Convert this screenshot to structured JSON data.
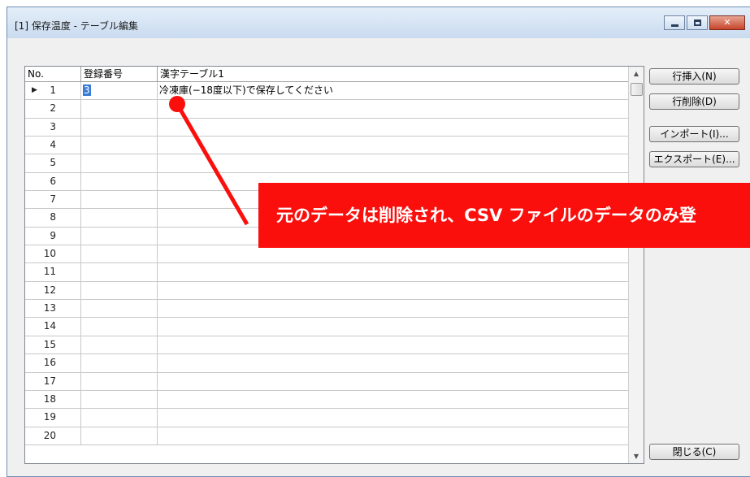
{
  "window": {
    "title": "[1] 保存温度 - テーブル編集",
    "controls": {
      "minimize": "–",
      "maximize": "□",
      "close": "✕"
    },
    "help_glyph": "?"
  },
  "grid": {
    "headers": {
      "no": "No.",
      "reg": "登録番号",
      "kanji": "漢字テーブル1"
    },
    "rows": [
      {
        "no": "1",
        "reg": "3",
        "kanji": "冷凍庫(−18度以下)で保存してください",
        "current": true
      },
      {
        "no": "2",
        "reg": "",
        "kanji": ""
      },
      {
        "no": "3",
        "reg": "",
        "kanji": ""
      },
      {
        "no": "4",
        "reg": "",
        "kanji": ""
      },
      {
        "no": "5",
        "reg": "",
        "kanji": ""
      },
      {
        "no": "6",
        "reg": "",
        "kanji": ""
      },
      {
        "no": "7",
        "reg": "",
        "kanji": ""
      },
      {
        "no": "8",
        "reg": "",
        "kanji": ""
      },
      {
        "no": "9",
        "reg": "",
        "kanji": ""
      },
      {
        "no": "10",
        "reg": "",
        "kanji": ""
      },
      {
        "no": "11",
        "reg": "",
        "kanji": ""
      },
      {
        "no": "12",
        "reg": "",
        "kanji": ""
      },
      {
        "no": "13",
        "reg": "",
        "kanji": ""
      },
      {
        "no": "14",
        "reg": "",
        "kanji": ""
      },
      {
        "no": "15",
        "reg": "",
        "kanji": ""
      },
      {
        "no": "16",
        "reg": "",
        "kanji": ""
      },
      {
        "no": "17",
        "reg": "",
        "kanji": ""
      },
      {
        "no": "18",
        "reg": "",
        "kanji": ""
      },
      {
        "no": "19",
        "reg": "",
        "kanji": ""
      },
      {
        "no": "20",
        "reg": "",
        "kanji": ""
      }
    ],
    "row_indicator": "▶",
    "scroll_up": "▲",
    "scroll_down": "▼"
  },
  "buttons": {
    "insert_row": "行挿入(N)",
    "delete_row": "行削除(D)",
    "import": "インポート(I)...",
    "export": "エクスポート(E)...",
    "close": "閉じる(C)"
  },
  "annotation": {
    "text": "元のデータは削除され、CSV ファイルのデータのみ登",
    "color": "#fa0f0c"
  }
}
